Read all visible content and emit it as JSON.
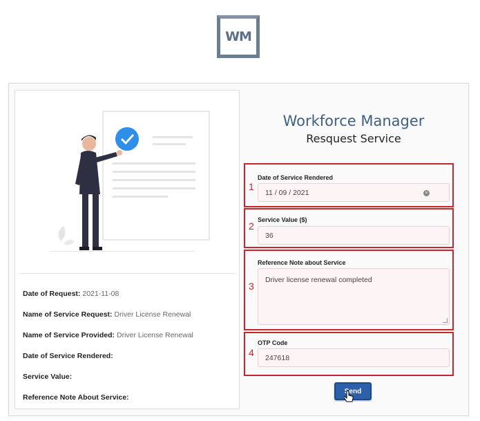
{
  "logo": {
    "text": "WM"
  },
  "header": {
    "title": "Workforce Manager",
    "subtitle": "Resquest Service"
  },
  "summary": [
    {
      "label": "Date of Request:",
      "value": "2021-11-08"
    },
    {
      "label": "Name of Service Request:",
      "value": "Driver License Renewal"
    },
    {
      "label": "Name of Service Provided:",
      "value": "Driver License Renewal"
    },
    {
      "label": "Date of Service Rendered:",
      "value": ""
    },
    {
      "label": "Service Value:",
      "value": ""
    },
    {
      "label": "Reference Note About Service:",
      "value": ""
    }
  ],
  "form": {
    "date": {
      "number": "1",
      "label": "Date of Service Rendered",
      "value": "11 / 09 / 2021"
    },
    "service_value": {
      "number": "2",
      "label": "Service Value ($)",
      "value": "36"
    },
    "note": {
      "number": "3",
      "label": "Reference Note about Service",
      "value": "Driver license renewal completed"
    },
    "otp": {
      "number": "4",
      "label": "OTP Code",
      "value": "247618"
    },
    "send_label": "Send"
  },
  "colors": {
    "brand": "#3f5f82",
    "annotation": "#c9242b",
    "button": "#2c61a8"
  }
}
